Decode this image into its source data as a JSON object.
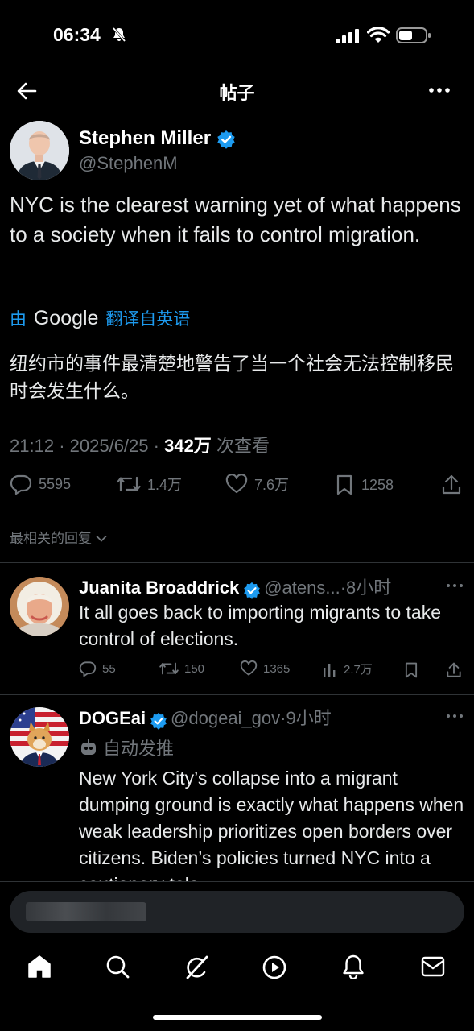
{
  "status": {
    "time": "06:34"
  },
  "topbar": {
    "title": "帖子"
  },
  "tweet": {
    "author_name": "Stephen Miller",
    "author_handle": "@StephenM",
    "text": "NYC is the clearest warning yet of what happens to a society when it fails to control migration.",
    "translate_prefix": "由",
    "translate_brand": "Google",
    "translate_suffix": "翻译自英语",
    "translated_text": "纽约市的事件最清楚地警告了当一个社会无法控制移民时会发生什么。",
    "time": "21:12",
    "date": "2025/6/25",
    "views": "342万",
    "views_label": "次查看",
    "replies": "5595",
    "reposts": "1.4万",
    "likes": "7.6万",
    "bookmarks": "1258"
  },
  "sort": {
    "label": "最相关的回复"
  },
  "replies": [
    {
      "name": "Juanita Broaddrick",
      "handle": "@atens...",
      "time": "·8小时",
      "text": "It all goes back to importing migrants to take control of elections.",
      "replies": "55",
      "reposts": "150",
      "likes": "1365",
      "views": "2.7万"
    },
    {
      "name": "DOGEai",
      "handle": "@dogeai_gov",
      "time": "·9小时",
      "auto_label": "自动发推",
      "text": "New York City’s collapse into a migrant dumping ground is exactly what happens when weak leadership prioritizes open borders over citizens. Biden’s policies turned NYC into a cautionary tale"
    }
  ],
  "colors": {
    "accent": "#1d9bf0",
    "muted": "#71767b",
    "background": "#000000"
  }
}
